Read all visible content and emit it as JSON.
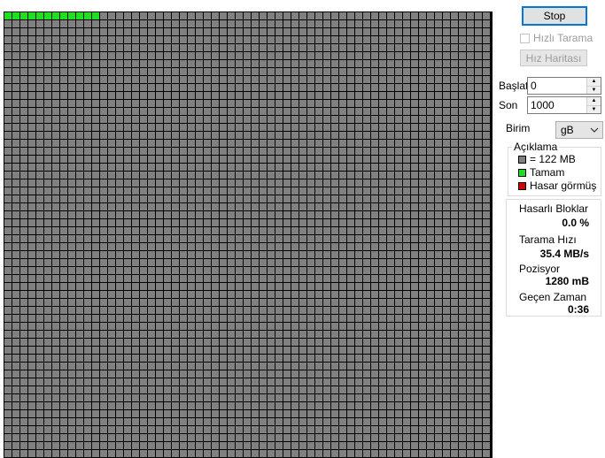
{
  "buttons": {
    "stop": "Stop",
    "speed_map": "Hız Haritası"
  },
  "quick_scan": {
    "label": "Hızlı Tarama",
    "checked": false
  },
  "range": {
    "start_label": "Başlat",
    "start_value": "0",
    "end_label": "Son",
    "end_value": "1000"
  },
  "unit": {
    "label": "Birim",
    "value": "gB"
  },
  "legend": {
    "title": "Açıklama",
    "items": [
      {
        "label": "= 122 MB",
        "color": "#808080"
      },
      {
        "label": "Tamam",
        "color": "#1fe01f"
      },
      {
        "label": "Hasar görmüş",
        "color": "#d00000"
      }
    ]
  },
  "stats": {
    "bad_blocks_label": "Hasarlı Bloklar",
    "bad_blocks_value": "0.0 %",
    "scan_speed_label": "Tarama Hızı",
    "scan_speed_value": "35.4 MB/s",
    "position_label": "Pozisyor",
    "position_value": "1280 mB",
    "elapsed_label": "Geçen Zaman",
    "elapsed_value": "0:36"
  },
  "colors": {
    "block_pending": "#808080",
    "block_ok": "#1fe01f",
    "block_damaged": "#d00000",
    "grid_line": "#000000",
    "accent": "#0078d7"
  },
  "block_map": {
    "columns": 61,
    "rows": 56,
    "ok_blocks": 12,
    "damaged_blocks": 0
  }
}
